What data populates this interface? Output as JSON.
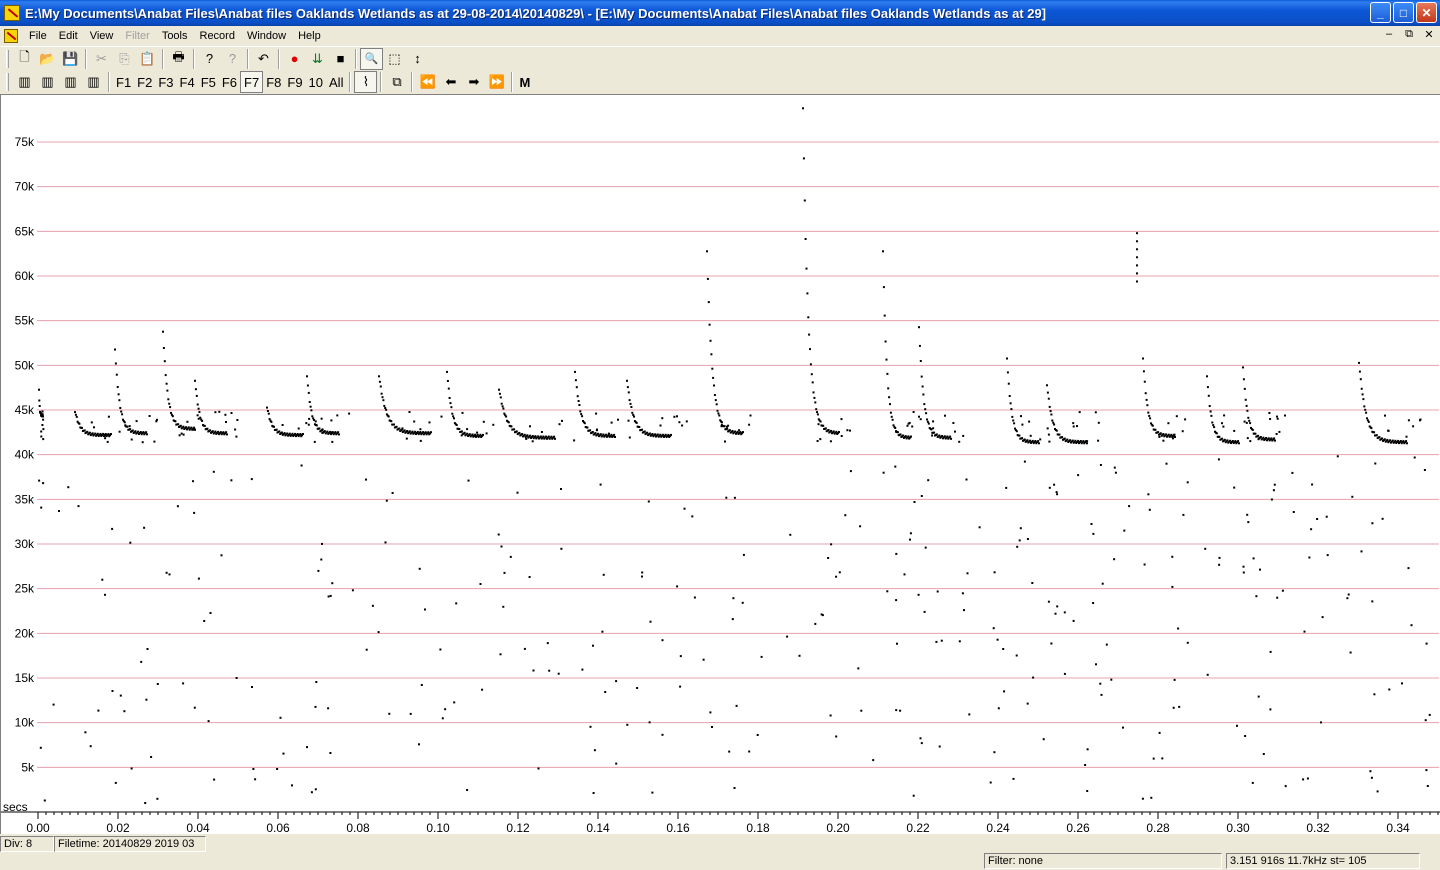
{
  "window": {
    "title": "E:\\My Documents\\Anabat Files\\Anabat files Oaklands Wetlands as at 29-08-2014\\20140829\\ - [E:\\My Documents\\Anabat Files\\Anabat files Oaklands Wetlands as at 29]",
    "minimize_glyph": "_",
    "maximize_glyph": "□",
    "close_glyph": "✕"
  },
  "menu": {
    "items": [
      {
        "label": "File",
        "enabled": true
      },
      {
        "label": "Edit",
        "enabled": true
      },
      {
        "label": "View",
        "enabled": true
      },
      {
        "label": "Filter",
        "enabled": false
      },
      {
        "label": "Tools",
        "enabled": true
      },
      {
        "label": "Record",
        "enabled": true
      },
      {
        "label": "Window",
        "enabled": true
      },
      {
        "label": "Help",
        "enabled": true
      }
    ],
    "mdi_minimize": "–",
    "mdi_restore": "⧉",
    "mdi_close": "✕"
  },
  "toolbar1": {
    "icons": [
      "new-file-icon",
      "open-folder-icon",
      "save-icon",
      "cut-icon",
      "copy-icon",
      "paste-icon",
      "print-icon",
      "help-icon",
      "context-help-icon",
      "undo-icon",
      "record-icon",
      "download-icon",
      "stop-icon",
      "zoom-icon",
      "select-rect-icon",
      "expand-vertical-icon"
    ],
    "glyphs": {
      "new-file-icon": "🗋",
      "open-folder-icon": "📂",
      "save-icon": "💾",
      "cut-icon": "✂",
      "copy-icon": "⎘",
      "paste-icon": "📋",
      "print-icon": "🖶",
      "help-icon": "?",
      "context-help-icon": "?",
      "undo-icon": "↶",
      "record-icon": "●",
      "download-icon": "⇊",
      "stop-icon": "■",
      "zoom-icon": "🔍",
      "select-rect-icon": "⬚",
      "expand-vertical-icon": "↕"
    }
  },
  "toolbar2": {
    "compress_glyphs": [
      "▥",
      "▥",
      "▥",
      "▥"
    ],
    "f_buttons": [
      "F1",
      "F2",
      "F3",
      "F4",
      "F5",
      "F6",
      "F7",
      "F8",
      "F9",
      "10",
      "All"
    ],
    "pressed_button": "F7",
    "glyphs": {
      "curve": "⌇",
      "dots": "⧉",
      "first": "⏮",
      "prev": "◀",
      "next": "▶",
      "last": "⏭"
    },
    "nav": [
      "⏪",
      "⬅",
      "➡",
      "⏩"
    ],
    "m_label": "M"
  },
  "chart_data": {
    "type": "scatter",
    "x_unit_label": "secs",
    "xlim": [
      0,
      0.35
    ],
    "ylim": [
      0,
      80000
    ],
    "y_ticks": [
      5000,
      10000,
      15000,
      20000,
      25000,
      30000,
      35000,
      40000,
      45000,
      50000,
      55000,
      60000,
      65000,
      70000,
      75000
    ],
    "y_tick_labels": [
      "5k",
      "10k",
      "15k",
      "20k",
      "25k",
      "30k",
      "35k",
      "40k",
      "45k",
      "50k",
      "55k",
      "60k",
      "65k",
      "70k",
      "75k"
    ],
    "x_ticks": [
      0,
      0.02,
      0.04,
      0.06,
      0.08,
      0.1,
      0.12,
      0.14,
      0.16,
      0.18,
      0.2,
      0.22,
      0.24,
      0.26,
      0.28,
      0.3,
      0.32,
      0.34
    ],
    "x_tick_labels": [
      "0.00",
      "0.02",
      "0.04",
      "0.06",
      "0.08",
      "0.10",
      "0.12",
      "0.14",
      "0.16",
      "0.18",
      "0.20",
      "0.22",
      "0.24",
      "0.26",
      "0.28",
      "0.30",
      "0.32",
      "0.34"
    ],
    "gridline_color": "#e8a0b0",
    "pulses": [
      {
        "t": 0.0,
        "start": 47500,
        "end": 44500,
        "dur": 0.001
      },
      {
        "t": 0.009,
        "start": 45000,
        "end": 42300,
        "dur": 0.009
      },
      {
        "t": 0.019,
        "start": 52000,
        "end": 42500,
        "dur": 0.008
      },
      {
        "t": 0.031,
        "start": 54000,
        "end": 43000,
        "dur": 0.008
      },
      {
        "t": 0.039,
        "start": 48500,
        "end": 42500,
        "dur": 0.008
      },
      {
        "t": 0.057,
        "start": 45500,
        "end": 42300,
        "dur": 0.009
      },
      {
        "t": 0.067,
        "start": 49000,
        "end": 42500,
        "dur": 0.008
      },
      {
        "t": 0.085,
        "start": 49000,
        "end": 42500,
        "dur": 0.013
      },
      {
        "t": 0.102,
        "start": 49500,
        "end": 42200,
        "dur": 0.009
      },
      {
        "t": 0.115,
        "start": 47500,
        "end": 42000,
        "dur": 0.014
      },
      {
        "t": 0.134,
        "start": 49500,
        "end": 42200,
        "dur": 0.01
      },
      {
        "t": 0.147,
        "start": 48500,
        "end": 42200,
        "dur": 0.011
      },
      {
        "t": 0.167,
        "start": 63000,
        "end": 42500,
        "dur": 0.009
      },
      {
        "t": 0.191,
        "start": 79000,
        "end": 42500,
        "dur": 0.009
      },
      {
        "t": 0.211,
        "start": 63000,
        "end": 42000,
        "dur": 0.007
      },
      {
        "t": 0.22,
        "start": 54500,
        "end": 42000,
        "dur": 0.008
      },
      {
        "t": 0.242,
        "start": 51000,
        "end": 41500,
        "dur": 0.008
      },
      {
        "t": 0.252,
        "start": 48000,
        "end": 41500,
        "dur": 0.01
      },
      {
        "t": 0.276,
        "start": 51000,
        "end": 42200,
        "dur": 0.008
      },
      {
        "t": 0.292,
        "start": 49000,
        "end": 41500,
        "dur": 0.008
      },
      {
        "t": 0.301,
        "start": 50000,
        "end": 41800,
        "dur": 0.008
      },
      {
        "t": 0.33,
        "start": 50500,
        "end": 41500,
        "dur": 0.012
      }
    ],
    "tall_dots": [
      {
        "t": 0.2745,
        "from": 59500,
        "to": 65500
      }
    ],
    "noise_seed": 7,
    "noise_count": 330
  },
  "status": {
    "div": "Div: 8",
    "filetime": "Filetime: 20140829 2019 03",
    "filter": "Filter: none",
    "readout": "3.151 916s  11.7kHz st=   105"
  }
}
